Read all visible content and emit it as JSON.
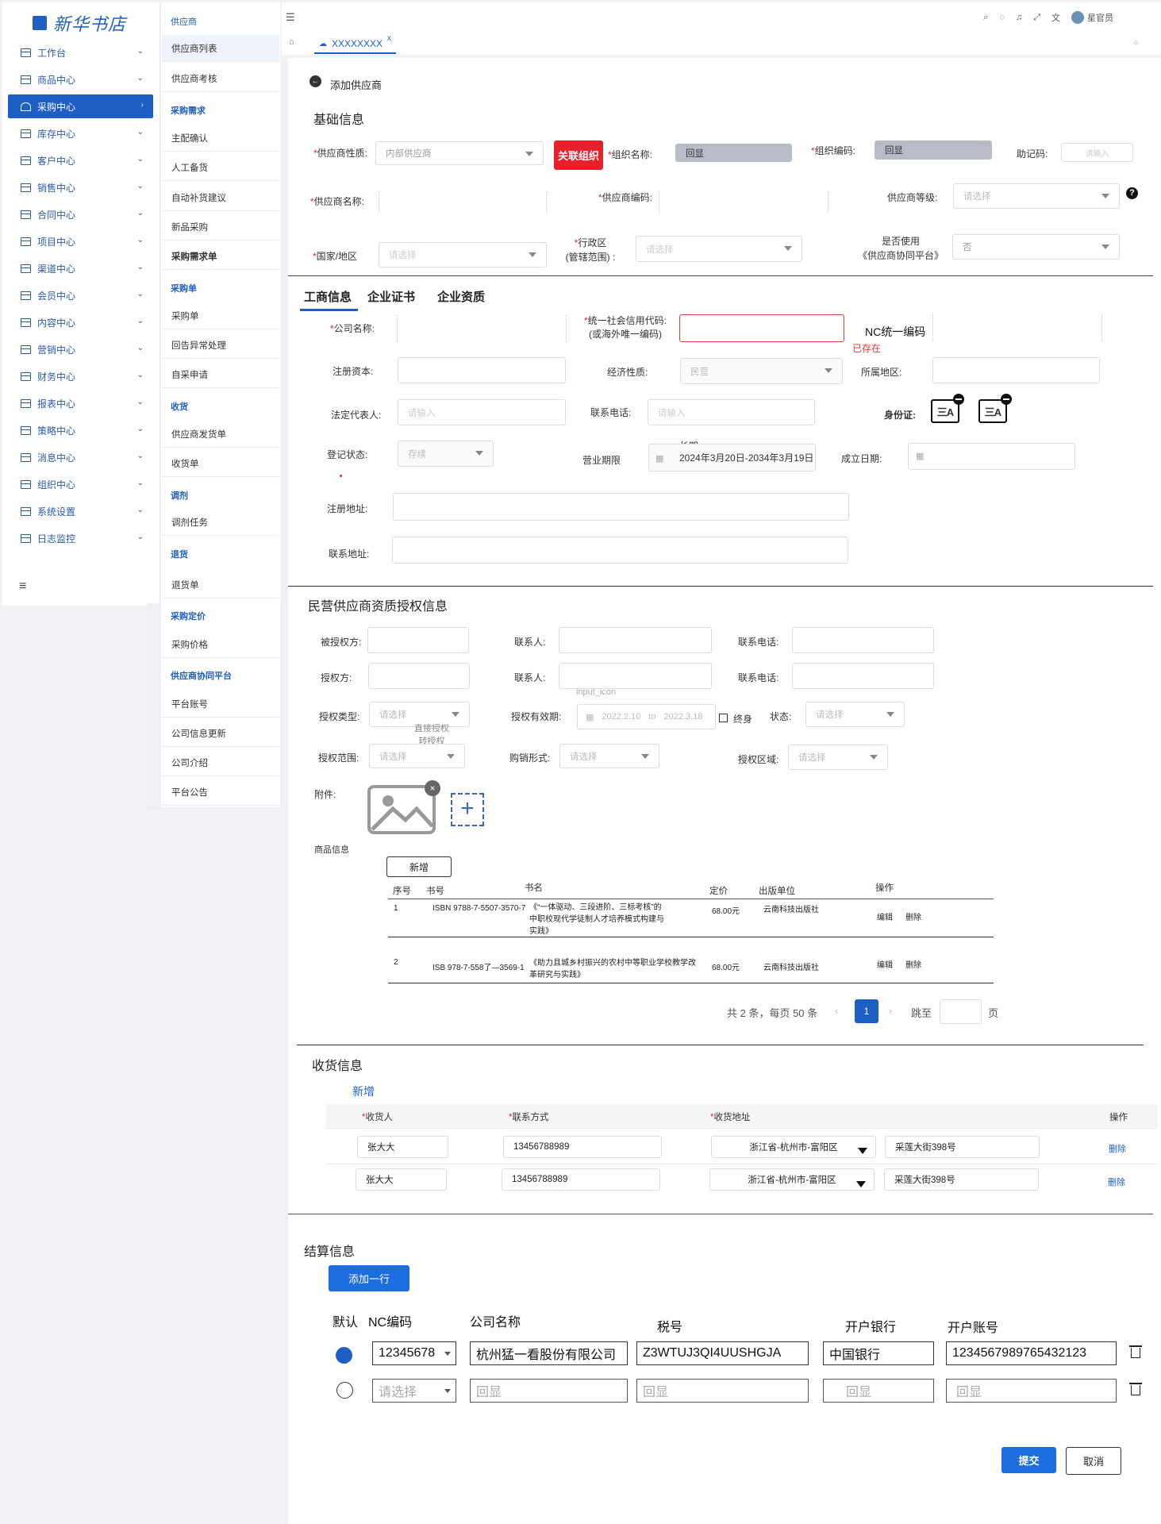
{
  "logo": {
    "text": "新华书店"
  },
  "sidebar": {
    "items": [
      {
        "label": "工作台"
      },
      {
        "label": "商品中心"
      },
      {
        "label": "采购中心"
      },
      {
        "label": "库存中心"
      },
      {
        "label": "客户中心"
      },
      {
        "label": "销售中心"
      },
      {
        "label": "合同中心"
      },
      {
        "label": "项目中心"
      },
      {
        "label": "渠道中心"
      },
      {
        "label": "会员中心"
      },
      {
        "label": "内容中心"
      },
      {
        "label": "营销中心"
      },
      {
        "label": "财务中心"
      },
      {
        "label": "报表中心"
      },
      {
        "label": "策略中心"
      },
      {
        "label": "消息中心"
      },
      {
        "label": "组织中心"
      },
      {
        "label": "系统设置"
      },
      {
        "label": "日志监控"
      }
    ]
  },
  "submenu": {
    "sec_supplier": "供应商",
    "supplier_list": "供应商列表",
    "supplier_eval": "供应商考核",
    "sec_demand": "采购需求",
    "item_main_confirm": "主配确认",
    "item_manual": "人工备货",
    "item_auto": "自动补货建议",
    "item_new": "新品采购",
    "item_demand_list": "采购需求单",
    "sec_order": "采购单",
    "item_order": "采购单",
    "item_exception": "回告异常处理",
    "item_self": "自采申请",
    "sec_receive": "收货",
    "item_ship": "供应商发货单",
    "item_receipt": "收货单",
    "sec_transfer": "调剂",
    "item_transfer_task": "调剂任务",
    "sec_return": "退货",
    "item_return": "退货单",
    "sec_pricing": "采购定价",
    "item_price": "采购价格",
    "sec_platform": "供应商协同平台",
    "item_account": "平台账号",
    "item_update": "公司信息更新",
    "item_intro": "公司介绍",
    "item_notice": "平台公告"
  },
  "topbar": {
    "tab": "XXXXXXXX",
    "user": "星官员"
  },
  "page": {
    "back_title": "添加供应商"
  },
  "basic": {
    "title": "基础信息",
    "nature_label": "供应商性质:",
    "nature_value": "内部供应商",
    "link_org_btn": "关联组织",
    "org_name_label": "组织名称:",
    "org_name_value": "回显",
    "org_code_label": "组织编码:",
    "org_code_value": "回显",
    "memo_label": "助记码:",
    "memo_ph": "请输入",
    "name_label": "供应商名称:",
    "code_label": "供应商编码:",
    "level_label": "供应商等级:",
    "level_ph": "请选择",
    "help_icon": "?",
    "country_label": "国家/地区",
    "country_ph": "请选择",
    "region_label_1": "行政区",
    "region_label_2": "(管辖范围) :",
    "region_ph": "请选择",
    "platform_label_1": "是否使用",
    "platform_label_2": "《供应商协同平台》",
    "platform_value": "否"
  },
  "tabs": [
    "工商信息",
    "企业证书",
    "企业资质"
  ],
  "biz": {
    "company_label": "公司名称:",
    "credit_label_1": "统一社会信用代码:",
    "credit_label_2": "(或海外唯一编码)",
    "exists": "已存在",
    "nc_label": "NC统一编码",
    "capital_label": "注册资本:",
    "econ_label": "经济性质:",
    "econ_value": "民营",
    "area_label": "所属地区:",
    "legal_label": "法定代表人:",
    "legal_ph": "请输入",
    "phone_label": "联系电话:",
    "phone_ph": "请输入",
    "id_label": "身份证:",
    "id_icon_text": "三A",
    "status_label": "登记状态:",
    "status_value": "存续",
    "term_label": "营业期限",
    "term_long": "长期",
    "term_value": "2024年3月20日-2034年3月19日",
    "found_label": "成立日期:",
    "reg_addr_label": "注册地址:",
    "contact_addr_label": "联系地址:"
  },
  "auth": {
    "title": "民营供应商资质授权信息",
    "grantee_label": "被授权方:",
    "contact_label": "联系人:",
    "phone_label": "联系电话:",
    "grantor_label": "授权方:",
    "type_label": "授权类型:",
    "type_ph": "请选择",
    "type_opt1": "直接授权",
    "type_opt2": "转授权",
    "valid_label": "授权有效期:",
    "input_icon": "input_icon",
    "date_from": "2022.2.10",
    "date_to_word": "to",
    "date_to": "2022.3.18",
    "lifetime": "终身",
    "state_label": "状态:",
    "state_ph": "请选择",
    "scope_label": "授权范围:",
    "scope_ph": "请选择",
    "sale_label": "购销形式:",
    "sale_ph": "请选择",
    "region_label": "授权区域:",
    "region_ph": "请选择",
    "attach_label": "附件:",
    "goods_label": "商品信息",
    "add_btn": "新增",
    "cols": [
      "序号",
      "书号",
      "书名",
      "定价",
      "出版单位",
      "操作"
    ],
    "rows": [
      {
        "no": "1",
        "isbn": "ISBN 9788-7-5507-3570-7",
        "name": "《“一体驱动、三段进阶、三标考核”的中职校现代学徒制人才培养模式构建与实践》",
        "price": "68.00元",
        "pub": "云南科技出版社",
        "edit": "编辑",
        "del": "删除"
      },
      {
        "no": "2",
        "isbn": "ISB 978-7-558了—3569-1",
        "name": "《助力且城乡村振兴的农村中等职业学校教学改革研究与实践》",
        "price": "68.00元",
        "pub": "云南科技出版社",
        "edit": "编辑",
        "del": "删除"
      }
    ],
    "pager_total": "共 2 条，每页 50 条",
    "pager_page": "1",
    "pager_jump": "跳至",
    "pager_unit": "页"
  },
  "receive": {
    "title": "收货信息",
    "add": "新增",
    "cols": [
      "收货人",
      "联系方式",
      "收货地址",
      "操作"
    ],
    "rows": [
      {
        "name": "张大大",
        "phone": "13456788989",
        "region": "浙江省-杭州市-富阳区",
        "street": "采莲大街398号",
        "del": "删除"
      },
      {
        "name": "张大大",
        "phone": "13456788989",
        "region": "浙江省-杭州市-富阳区",
        "street": "采莲大街398号",
        "del": "删除"
      }
    ]
  },
  "settle": {
    "title": "结算信息",
    "add_row": "添加一行",
    "cols": [
      "默认",
      "NC编码",
      "公司名称",
      "税号",
      "开户银行",
      "开户账号"
    ],
    "row1": {
      "nc": "12345678",
      "company": "杭州猛一看股份有限公司",
      "tax": "Z3WTUJ3QI4UUSHGJA",
      "bank": "中国银行",
      "account": "1234567989765432123"
    },
    "row2": {
      "nc": "请选择",
      "company": "回显",
      "tax": "回显",
      "bank": "回显",
      "account": "回显"
    },
    "submit": "提交",
    "cancel": "取消"
  },
  "colors": {
    "brand": "#1d5fc4",
    "danger": "#e8202a"
  }
}
